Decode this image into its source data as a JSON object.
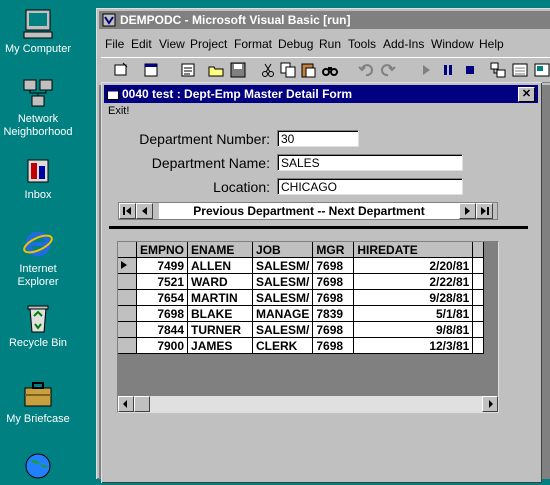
{
  "desktop": {
    "icons": [
      {
        "label_line1": "My Computer",
        "label_line2": "",
        "icon": "computer-icon"
      },
      {
        "label_line1": "Network",
        "label_line2": "Neighborhood",
        "icon": "network-icon"
      },
      {
        "label_line1": "Inbox",
        "label_line2": "",
        "icon": "inbox-icon"
      },
      {
        "label_line1": "Internet",
        "label_line2": "Explorer",
        "icon": "ie-icon"
      },
      {
        "label_line1": "Recycle Bin",
        "label_line2": "",
        "icon": "recycle-bin-icon"
      },
      {
        "label_line1": "My Briefcase",
        "label_line2": "",
        "icon": "briefcase-icon"
      }
    ]
  },
  "vb": {
    "title": "DEMPODC - Microsoft Visual Basic [run]",
    "menu": [
      "File",
      "Edit",
      "View",
      "Project",
      "Format",
      "Debug",
      "Run",
      "Tools",
      "Add-Ins",
      "Window",
      "Help"
    ]
  },
  "form": {
    "title": "0040 test : Dept-Emp Master Detail Form",
    "menu_exit": "Exit!",
    "dept_number_label": "Department Number:",
    "dept_number": "30",
    "dept_name_label": "Department Name:",
    "dept_name": "SALES",
    "location_label": "Location:",
    "location": "CHICAGO",
    "datacontrol_caption": "Previous Department -- Next Department"
  },
  "grid": {
    "columns": [
      "EMPNO",
      "ENAME",
      "JOB",
      "MGR",
      "HIREDATE"
    ],
    "rows": [
      [
        "7499",
        "ALLEN",
        "SALESM/",
        "7698",
        "2/20/81"
      ],
      [
        "7521",
        "WARD",
        "SALESM/",
        "7698",
        "2/22/81"
      ],
      [
        "7654",
        "MARTIN",
        "SALESM/",
        "7698",
        "9/28/81"
      ],
      [
        "7698",
        "BLAKE",
        "MANAGE",
        "7839",
        "5/1/81"
      ],
      [
        "7844",
        "TURNER",
        "SALESM/",
        "7698",
        "9/8/81"
      ],
      [
        "7900",
        "JAMES",
        "CLERK",
        "7698",
        "12/3/81"
      ]
    ]
  }
}
